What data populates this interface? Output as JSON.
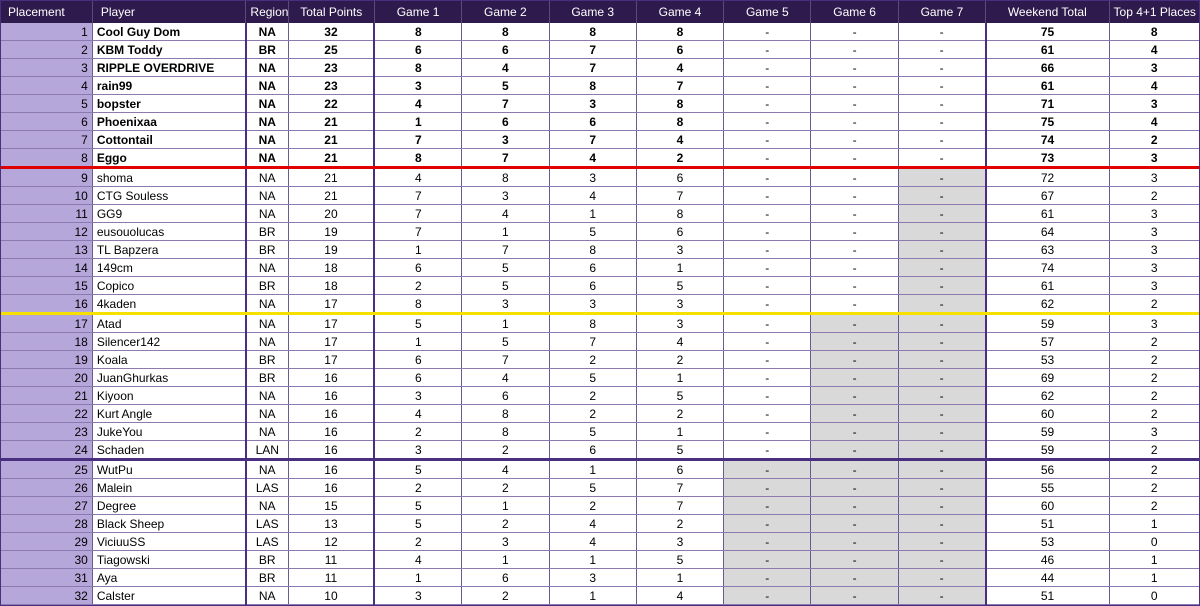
{
  "headers": [
    "Placement",
    "Player",
    "Region",
    "Total Points",
    "Game 1",
    "Game 2",
    "Game 3",
    "Game 4",
    "Game 5",
    "Game 6",
    "Game 7",
    "Weekend Total",
    "Top 4+1 Places"
  ],
  "rows": [
    {
      "place": "1",
      "player": "Cool Guy Dom",
      "region": "NA",
      "total": "32",
      "games": [
        "8",
        "8",
        "8",
        "8",
        "-",
        "-",
        "-"
      ],
      "weekend": "75",
      "top": "8"
    },
    {
      "place": "2",
      "player": "KBM Toddy",
      "region": "BR",
      "total": "25",
      "games": [
        "6",
        "6",
        "7",
        "6",
        "-",
        "-",
        "-"
      ],
      "weekend": "61",
      "top": "4"
    },
    {
      "place": "3",
      "player": "RIPPLE OVERDRIVE",
      "region": "NA",
      "total": "23",
      "games": [
        "8",
        "4",
        "7",
        "4",
        "-",
        "-",
        "-"
      ],
      "weekend": "66",
      "top": "3"
    },
    {
      "place": "4",
      "player": "rain99",
      "region": "NA",
      "total": "23",
      "games": [
        "3",
        "5",
        "8",
        "7",
        "-",
        "-",
        "-"
      ],
      "weekend": "61",
      "top": "4"
    },
    {
      "place": "5",
      "player": "bopster",
      "region": "NA",
      "total": "22",
      "games": [
        "4",
        "7",
        "3",
        "8",
        "-",
        "-",
        "-"
      ],
      "weekend": "71",
      "top": "3"
    },
    {
      "place": "6",
      "player": "Phoenixaa",
      "region": "NA",
      "total": "21",
      "games": [
        "1",
        "6",
        "6",
        "8",
        "-",
        "-",
        "-"
      ],
      "weekend": "75",
      "top": "4"
    },
    {
      "place": "7",
      "player": "Cottontail",
      "region": "NA",
      "total": "21",
      "games": [
        "7",
        "3",
        "7",
        "4",
        "-",
        "-",
        "-"
      ],
      "weekend": "74",
      "top": "2"
    },
    {
      "place": "8",
      "player": "Eggo",
      "region": "NA",
      "total": "21",
      "games": [
        "8",
        "7",
        "4",
        "2",
        "-",
        "-",
        "-"
      ],
      "weekend": "73",
      "top": "3"
    },
    {
      "place": "9",
      "player": "shoma",
      "region": "NA",
      "total": "21",
      "games": [
        "4",
        "8",
        "3",
        "6",
        "-",
        "-",
        "-"
      ],
      "weekend": "72",
      "top": "3"
    },
    {
      "place": "10",
      "player": "CTG Souless",
      "region": "NA",
      "total": "21",
      "games": [
        "7",
        "3",
        "4",
        "7",
        "-",
        "-",
        "-"
      ],
      "weekend": "67",
      "top": "2"
    },
    {
      "place": "11",
      "player": "GG9",
      "region": "NA",
      "total": "20",
      "games": [
        "7",
        "4",
        "1",
        "8",
        "-",
        "-",
        "-"
      ],
      "weekend": "61",
      "top": "3"
    },
    {
      "place": "12",
      "player": "eusouolucas",
      "region": "BR",
      "total": "19",
      "games": [
        "7",
        "1",
        "5",
        "6",
        "-",
        "-",
        "-"
      ],
      "weekend": "64",
      "top": "3"
    },
    {
      "place": "13",
      "player": "TL Bapzera",
      "region": "BR",
      "total": "19",
      "games": [
        "1",
        "7",
        "8",
        "3",
        "-",
        "-",
        "-"
      ],
      "weekend": "63",
      "top": "3"
    },
    {
      "place": "14",
      "player": "149cm",
      "region": "NA",
      "total": "18",
      "games": [
        "6",
        "5",
        "6",
        "1",
        "-",
        "-",
        "-"
      ],
      "weekend": "74",
      "top": "3"
    },
    {
      "place": "15",
      "player": "Copico",
      "region": "BR",
      "total": "18",
      "games": [
        "2",
        "5",
        "6",
        "5",
        "-",
        "-",
        "-"
      ],
      "weekend": "61",
      "top": "3"
    },
    {
      "place": "16",
      "player": "4kaden",
      "region": "NA",
      "total": "17",
      "games": [
        "8",
        "3",
        "3",
        "3",
        "-",
        "-",
        "-"
      ],
      "weekend": "62",
      "top": "2"
    },
    {
      "place": "17",
      "player": "Atad",
      "region": "NA",
      "total": "17",
      "games": [
        "5",
        "1",
        "8",
        "3",
        "-",
        "-",
        "-"
      ],
      "weekend": "59",
      "top": "3"
    },
    {
      "place": "18",
      "player": "Silencer142",
      "region": "NA",
      "total": "17",
      "games": [
        "1",
        "5",
        "7",
        "4",
        "-",
        "-",
        "-"
      ],
      "weekend": "57",
      "top": "2"
    },
    {
      "place": "19",
      "player": "Koala",
      "region": "BR",
      "total": "17",
      "games": [
        "6",
        "7",
        "2",
        "2",
        "-",
        "-",
        "-"
      ],
      "weekend": "53",
      "top": "2"
    },
    {
      "place": "20",
      "player": "JuanGhurkas",
      "region": "BR",
      "total": "16",
      "games": [
        "6",
        "4",
        "5",
        "1",
        "-",
        "-",
        "-"
      ],
      "weekend": "69",
      "top": "2"
    },
    {
      "place": "21",
      "player": "Kiyoon",
      "region": "NA",
      "total": "16",
      "games": [
        "3",
        "6",
        "2",
        "5",
        "-",
        "-",
        "-"
      ],
      "weekend": "62",
      "top": "2"
    },
    {
      "place": "22",
      "player": "Kurt Angle",
      "region": "NA",
      "total": "16",
      "games": [
        "4",
        "8",
        "2",
        "2",
        "-",
        "-",
        "-"
      ],
      "weekend": "60",
      "top": "2"
    },
    {
      "place": "23",
      "player": "JukeYou",
      "region": "NA",
      "total": "16",
      "games": [
        "2",
        "8",
        "5",
        "1",
        "-",
        "-",
        "-"
      ],
      "weekend": "59",
      "top": "3"
    },
    {
      "place": "24",
      "player": "Schaden",
      "region": "LAN",
      "total": "16",
      "games": [
        "3",
        "2",
        "6",
        "5",
        "-",
        "-",
        "-"
      ],
      "weekend": "59",
      "top": "2"
    },
    {
      "place": "25",
      "player": "WutPu",
      "region": "NA",
      "total": "16",
      "games": [
        "5",
        "4",
        "1",
        "6",
        "-",
        "-",
        "-"
      ],
      "weekend": "56",
      "top": "2"
    },
    {
      "place": "26",
      "player": "Malein",
      "region": "LAS",
      "total": "16",
      "games": [
        "2",
        "2",
        "5",
        "7",
        "-",
        "-",
        "-"
      ],
      "weekend": "55",
      "top": "2"
    },
    {
      "place": "27",
      "player": "Degree",
      "region": "NA",
      "total": "15",
      "games": [
        "5",
        "1",
        "2",
        "7",
        "-",
        "-",
        "-"
      ],
      "weekend": "60",
      "top": "2"
    },
    {
      "place": "28",
      "player": "Black Sheep",
      "region": "LAS",
      "total": "13",
      "games": [
        "5",
        "2",
        "4",
        "2",
        "-",
        "-",
        "-"
      ],
      "weekend": "51",
      "top": "1"
    },
    {
      "place": "29",
      "player": "ViciuuSS",
      "region": "LAS",
      "total": "12",
      "games": [
        "2",
        "3",
        "4",
        "3",
        "-",
        "-",
        "-"
      ],
      "weekend": "53",
      "top": "0"
    },
    {
      "place": "30",
      "player": "Tiagowski",
      "region": "BR",
      "total": "11",
      "games": [
        "4",
        "1",
        "1",
        "5",
        "-",
        "-",
        "-"
      ],
      "weekend": "46",
      "top": "1"
    },
    {
      "place": "31",
      "player": "Aya",
      "region": "BR",
      "total": "11",
      "games": [
        "1",
        "6",
        "3",
        "1",
        "-",
        "-",
        "-"
      ],
      "weekend": "44",
      "top": "1"
    },
    {
      "place": "32",
      "player": "Calster",
      "region": "NA",
      "total": "10",
      "games": [
        "3",
        "2",
        "1",
        "4",
        "-",
        "-",
        "-"
      ],
      "weekend": "51",
      "top": "0"
    }
  ],
  "colors": {
    "header_bg": "#2e1a4d",
    "placement_bg": "#b6a7db",
    "eliminated_bg": "#d9d9d9",
    "cut_top8": "#e00000",
    "cut_top16": "#f5e000",
    "cut_top24": "#4a2f80"
  }
}
